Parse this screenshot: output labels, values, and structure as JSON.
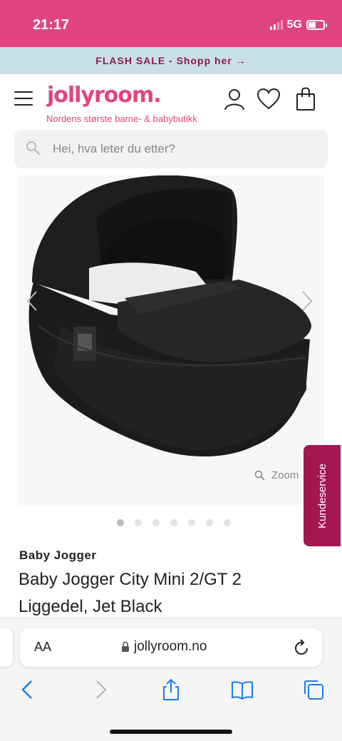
{
  "status_bar": {
    "time": "21:17",
    "network": "5G",
    "brand_color": "#e0447f"
  },
  "banner": {
    "text": "FLASH SALE - Shopp her →"
  },
  "header": {
    "logo": "jollyroom.",
    "tagline": "Nordens største barne- & babybutikk",
    "icons": [
      "menu-icon",
      "user-icon",
      "heart-icon",
      "shopping-bag-icon"
    ]
  },
  "search": {
    "placeholder": "Hei, hva leter du etter?"
  },
  "gallery": {
    "zoom_label": "Zoom",
    "image_count": 7,
    "active_index": 0
  },
  "side_tab": {
    "label": "Kundeservice"
  },
  "product": {
    "brand": "Baby Jogger",
    "title": "Baby Jogger City Mini 2/GT 2 Liggedel, Jet Black"
  },
  "browser": {
    "text_size_label": "AA",
    "url": "jollyroom.no",
    "toolbar_icons": [
      "back-icon",
      "forward-icon",
      "share-icon",
      "bookmarks-icon",
      "tabs-icon"
    ]
  }
}
